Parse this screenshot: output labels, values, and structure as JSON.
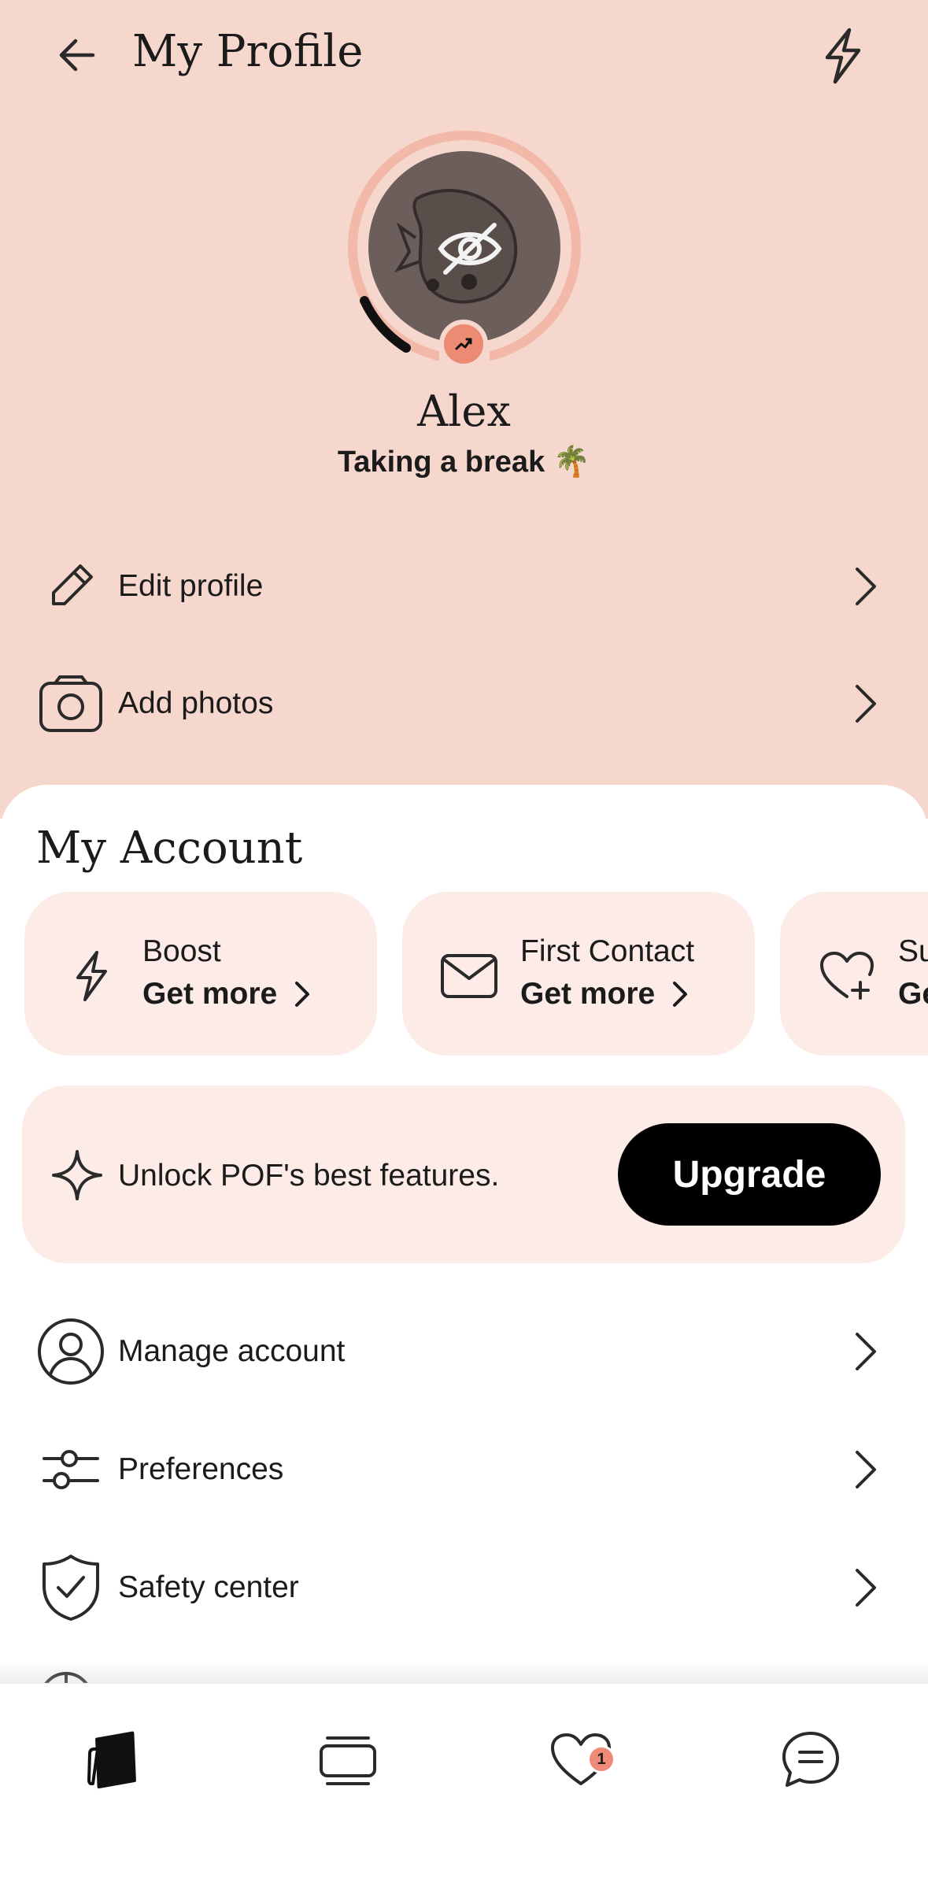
{
  "header": {
    "title": "My Profile",
    "back_icon": "arrow-left-icon",
    "action_icon": "lightning-bolt-icon"
  },
  "profile": {
    "name": "Alex",
    "status": "Taking a break 🌴",
    "avatar_icon": "hidden-eye-icon",
    "progress_fraction": 0.12
  },
  "profile_rows": [
    {
      "label": "Edit profile",
      "icon": "pencil-icon"
    },
    {
      "label": "Add photos",
      "icon": "camera-icon"
    }
  ],
  "account": {
    "title": "My Account",
    "cards": [
      {
        "title": "Boost",
        "action": "Get more",
        "icon": "lightning-bolt-icon"
      },
      {
        "title": "First Contact",
        "action": "Get more",
        "icon": "envelope-icon"
      },
      {
        "title": "Su",
        "action": "Ge",
        "icon": "heart-plus-icon"
      }
    ],
    "unlock": {
      "text": "Unlock POF's best features.",
      "button": "Upgrade",
      "icon": "sparkle-icon"
    },
    "rows": [
      {
        "label": "Manage account",
        "icon": "user-circle-icon"
      },
      {
        "label": "Preferences",
        "icon": "sliders-icon"
      },
      {
        "label": "Safety center",
        "icon": "shield-check-icon"
      }
    ]
  },
  "bottom_nav": {
    "items": [
      "cards-icon",
      "stack-icon",
      "heart-icon",
      "chat-icon"
    ],
    "likes_badge": "1"
  },
  "colors": {
    "header_bg": "#f6d7ce",
    "card_bg": "#fcebe6",
    "accent": "#ec8a74",
    "button": "#000000"
  }
}
